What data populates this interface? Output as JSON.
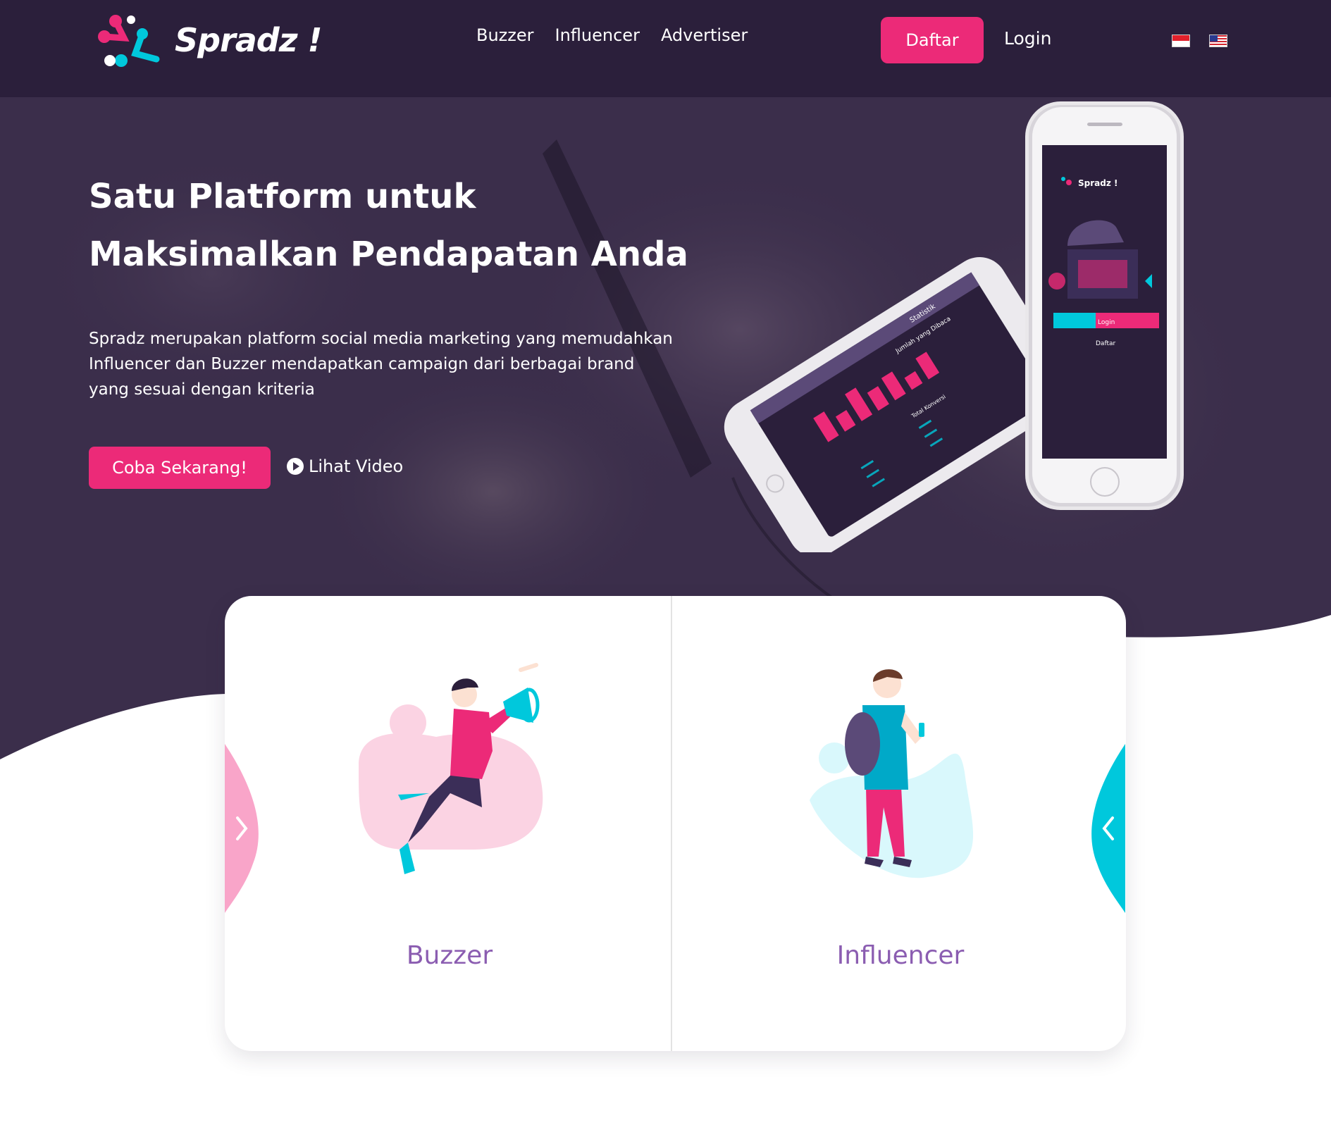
{
  "brand": {
    "name": "Spradz !",
    "primary_color": "#ec2a78",
    "secondary_color": "#00c8dc",
    "header_color": "#2b1f3b"
  },
  "nav": {
    "links": [
      "Buzzer",
      "Influencer",
      "Advertiser"
    ],
    "daftar_label": "Daftar",
    "login_label": "Login",
    "flags": [
      "flag-id-icon",
      "flag-us-icon"
    ]
  },
  "hero": {
    "title_line1": "Satu Platform untuk",
    "title_line2": "Maksimalkan Pendapatan Anda",
    "description": "Spradz merupakan platform social media marketing yang memudahkan Influencer dan Buzzer mendapatkan campaign dari berbagai brand yang sesuai dengan kriteria",
    "cta_label": "Coba Sekarang!",
    "video_label": "Lihat Video"
  },
  "phone_mockup": {
    "brand": "Spradz !",
    "stats_title": "Statistik",
    "stats_subtitle": "Jumlah yang Dibaca",
    "total_label": "Total Konversi",
    "login_btn": "Login",
    "daftar_btn": "Daftar"
  },
  "cards": [
    {
      "label": "Buzzer",
      "illustration": "buzzer-megaphone-illustration"
    },
    {
      "label": "Influencer",
      "illustration": "influencer-phone-illustration"
    }
  ]
}
